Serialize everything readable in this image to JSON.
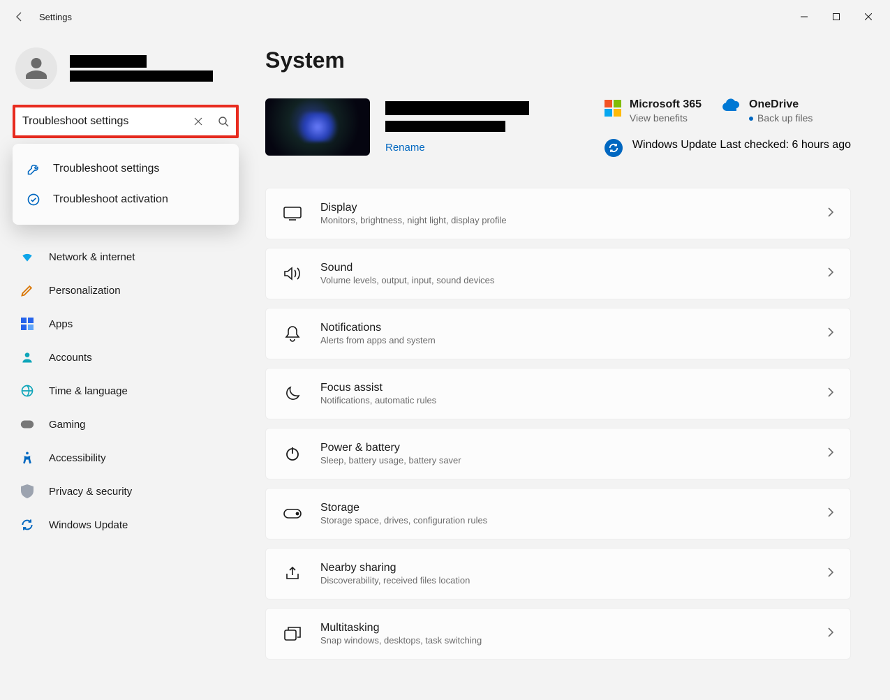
{
  "window": {
    "title": "Settings"
  },
  "search": {
    "value": "Troubleshoot settings",
    "suggestions": [
      "Troubleshoot settings",
      "Troubleshoot activation"
    ]
  },
  "nav": {
    "items": [
      {
        "label": "Network & internet"
      },
      {
        "label": "Personalization"
      },
      {
        "label": "Apps"
      },
      {
        "label": "Accounts"
      },
      {
        "label": "Time & language"
      },
      {
        "label": "Gaming"
      },
      {
        "label": "Accessibility"
      },
      {
        "label": "Privacy & security"
      },
      {
        "label": "Windows Update"
      }
    ]
  },
  "page": {
    "title": "System",
    "rename": "Rename"
  },
  "hero": {
    "ms365": {
      "title": "Microsoft 365",
      "sub": "View benefits"
    },
    "onedrive": {
      "title": "OneDrive",
      "sub": "Back up files"
    },
    "update": {
      "title": "Windows Update",
      "sub": "Last checked: 6 hours ago"
    }
  },
  "cards": [
    {
      "title": "Display",
      "sub": "Monitors, brightness, night light, display profile"
    },
    {
      "title": "Sound",
      "sub": "Volume levels, output, input, sound devices"
    },
    {
      "title": "Notifications",
      "sub": "Alerts from apps and system"
    },
    {
      "title": "Focus assist",
      "sub": "Notifications, automatic rules"
    },
    {
      "title": "Power & battery",
      "sub": "Sleep, battery usage, battery saver"
    },
    {
      "title": "Storage",
      "sub": "Storage space, drives, configuration rules"
    },
    {
      "title": "Nearby sharing",
      "sub": "Discoverability, received files location"
    },
    {
      "title": "Multitasking",
      "sub": "Snap windows, desktops, task switching"
    }
  ]
}
